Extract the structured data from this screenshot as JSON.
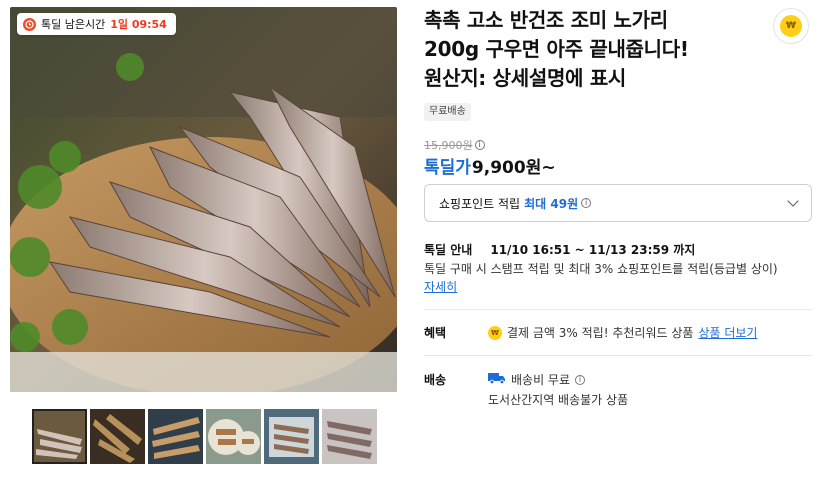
{
  "timer": {
    "label": "톡딜 남은시간",
    "remaining": "1일 09:54"
  },
  "product": {
    "title_line1": "촉촉 고소 반건조 조미 노가리",
    "title_line2": "200g 구우면 아주 끝내줍니다!",
    "title_line3": "원산지: 상세설명에 표시",
    "free_shipping_badge": "무료배송",
    "original_price": "15,900원",
    "deal_label": "톡딜가",
    "deal_price": "9,900원~"
  },
  "points": {
    "label": "쇼핑포인트 적립",
    "max_text": "최대 49원"
  },
  "deal_info": {
    "title": "톡딜 안내",
    "period": "11/10 16:51 ~ 11/13 23:59 까지",
    "description": "톡딜 구매 시 스탬프 적립 및 최대 3% 쇼핑포인트를 적립(등급별 상이)",
    "detail_link": "자세히"
  },
  "benefit": {
    "label": "혜택",
    "text": "결제 금액 3% 적립! 추천리워드 상품",
    "more_link": "상품 더보기"
  },
  "shipping": {
    "label": "배송",
    "fee": "배송비 무료",
    "note": "도서산간지역 배송불가 상품"
  },
  "icons": {
    "coin_symbol": "₩",
    "info_symbol": "i"
  },
  "colors": {
    "accent_blue": "#1d6dd6",
    "timer_red": "#f03b20",
    "coin_yellow": "#ffcf16"
  }
}
